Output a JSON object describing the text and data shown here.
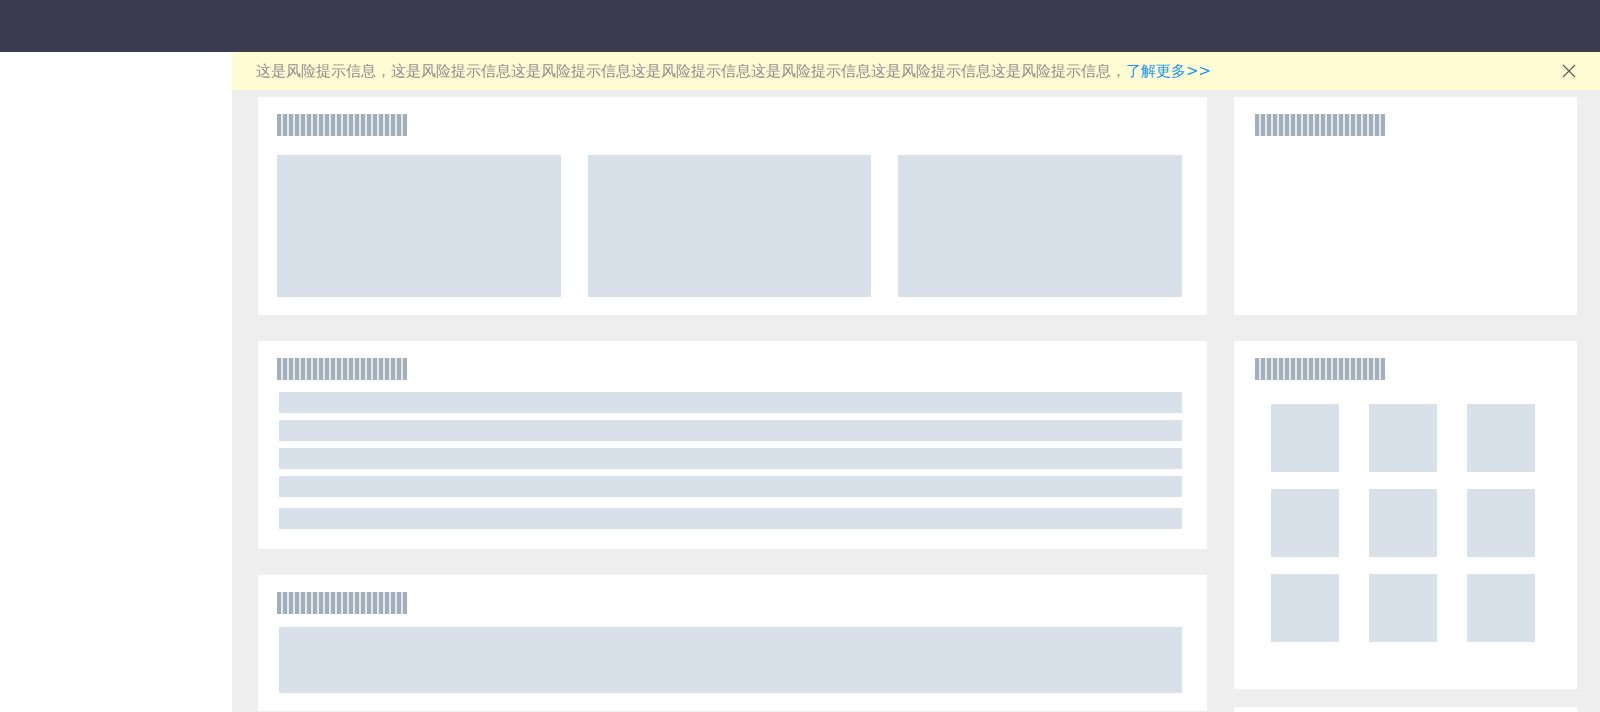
{
  "notice": {
    "message": "这是风险提示信息，这是风险提示信息这是风险提示信息这是风险提示信息这是风险提示信息这是风险提示信息这是风险提示信息，",
    "link": "了解更多>>"
  },
  "main_cards": [
    {
      "kind": "gallery",
      "placeholders": [
        {
          "kind": "title"
        },
        {
          "kind": "block"
        },
        {
          "kind": "block"
        },
        {
          "kind": "block"
        }
      ]
    },
    {
      "kind": "list",
      "placeholders": [
        {
          "kind": "title"
        },
        {
          "kind": "line"
        },
        {
          "kind": "line"
        },
        {
          "kind": "line"
        },
        {
          "kind": "line"
        },
        {
          "kind": "line"
        }
      ]
    },
    {
      "kind": "banner",
      "placeholders": [
        {
          "kind": "title"
        },
        {
          "kind": "wide"
        }
      ]
    }
  ],
  "side_cards": [
    {
      "kind": "blank",
      "placeholders": [
        {
          "kind": "title"
        }
      ]
    },
    {
      "kind": "grid",
      "placeholders": [
        {
          "kind": "title"
        },
        {
          "kind": "tile"
        },
        {
          "kind": "tile"
        },
        {
          "kind": "tile"
        },
        {
          "kind": "tile"
        },
        {
          "kind": "tile"
        },
        {
          "kind": "tile"
        },
        {
          "kind": "tile"
        },
        {
          "kind": "tile"
        },
        {
          "kind": "tile"
        }
      ]
    },
    {
      "kind": "blank"
    }
  ]
}
